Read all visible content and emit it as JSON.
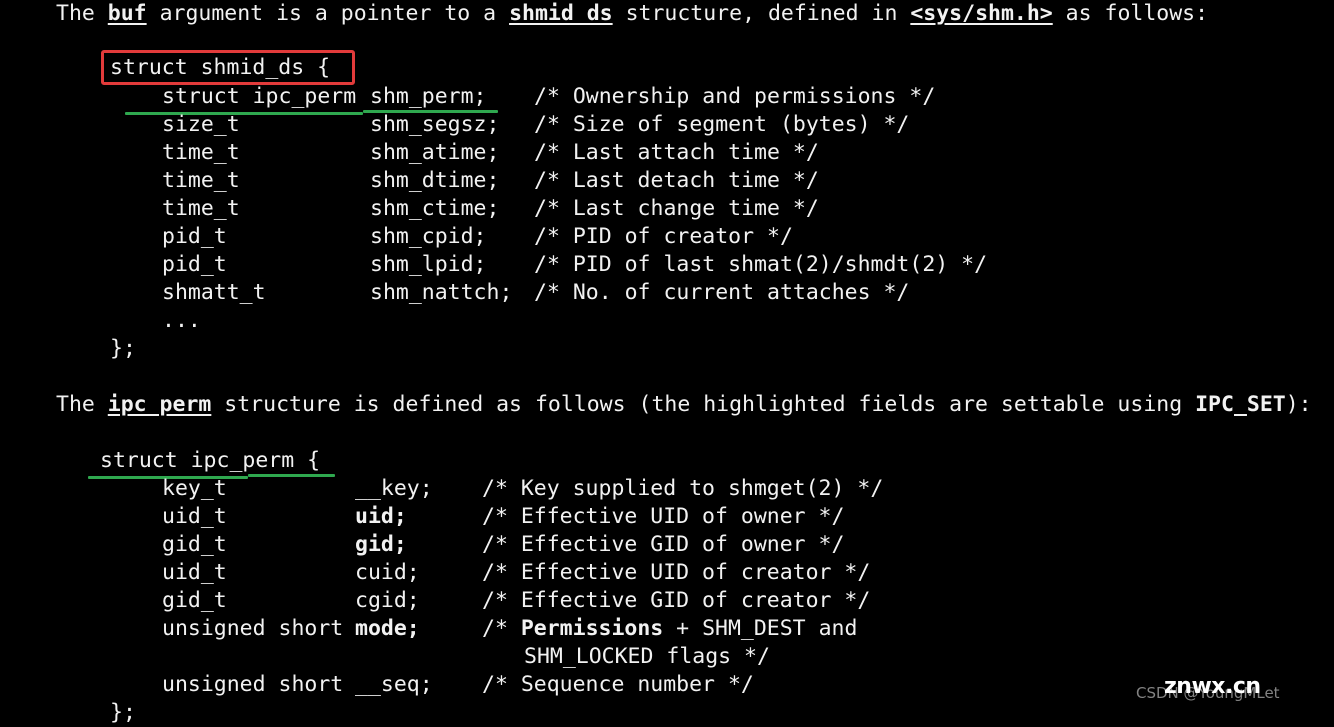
{
  "page": {
    "background_color": "#000000",
    "text_color": "#f2f2f2",
    "highlight_box_color": "#e23b3b",
    "underline_mark_color": "#2fa84f"
  },
  "intro": {
    "seg1": "The ",
    "buf": "buf",
    "seg2": " argument is a pointer to a ",
    "shmid_ds": "shmid ds",
    "seg3": " structure, defined in ",
    "header": "<sys/shm.h>",
    "seg4": " as follows:"
  },
  "shmid_ds_block": {
    "open_line": "struct shmid_ds {",
    "fields": [
      {
        "type": "struct ipc_perm",
        "name": "shm_perm;",
        "comment": "/* Ownership and permissions */"
      },
      {
        "type": "size_t",
        "name": "shm_segsz;",
        "comment": "/* Size of segment (bytes) */"
      },
      {
        "type": "time_t",
        "name": "shm_atime;",
        "comment": "/* Last attach time */"
      },
      {
        "type": "time_t",
        "name": "shm_dtime;",
        "comment": "/* Last detach time */"
      },
      {
        "type": "time_t",
        "name": "shm_ctime;",
        "comment": "/* Last change time */"
      },
      {
        "type": "pid_t",
        "name": "shm_cpid;",
        "comment": "/* PID of creator */"
      },
      {
        "type": "pid_t",
        "name": "shm_lpid;",
        "comment": "/* PID of last shmat(2)/shmdt(2) */"
      },
      {
        "type": "shmatt_t",
        "name": "shm_nattch;",
        "comment": "/* No. of current attaches */"
      }
    ],
    "ellipsis": "...",
    "close_line": "};"
  },
  "middle": {
    "seg1": "The ",
    "ipc_perm": "ipc perm",
    "seg2": " structure is defined as follows (the highlighted fields are settable using ",
    "ipc_set": "IPC_SET",
    "seg3": "):"
  },
  "ipc_perm_block": {
    "open_line": "struct ipc_perm {",
    "fields": [
      {
        "type": "key_t",
        "name": "__key;",
        "name_bold": false,
        "comment": "/* Key supplied to shmget(2) */",
        "comment_bold_prefix": ""
      },
      {
        "type": "uid_t",
        "name": "uid;",
        "name_bold": true,
        "comment": "/* Effective UID of owner */",
        "comment_bold_prefix": ""
      },
      {
        "type": "gid_t",
        "name": "gid;",
        "name_bold": true,
        "comment": "/* Effective GID of owner */",
        "comment_bold_prefix": ""
      },
      {
        "type": "uid_t",
        "name": "cuid;",
        "name_bold": false,
        "comment": "/* Effective UID of creator */",
        "comment_bold_prefix": ""
      },
      {
        "type": "gid_t",
        "name": "cgid;",
        "name_bold": false,
        "comment": "/* Effective GID of creator */",
        "comment_bold_prefix": ""
      },
      {
        "type": "unsigned short",
        "name": "mode;",
        "name_bold": true,
        "comment": " + SHM_DEST and",
        "comment_bold_prefix": "Permissions"
      }
    ],
    "mode_comment_open": "/* ",
    "mode_comment_cont": "SHM_LOCKED flags */",
    "seq_field": {
      "type": "unsigned short",
      "name": "__seq;",
      "comment": "/* Sequence number */"
    },
    "close_line": "};"
  },
  "watermark": {
    "csdn": "CSDN @YoungMLet",
    "site": "znwx.cn"
  }
}
